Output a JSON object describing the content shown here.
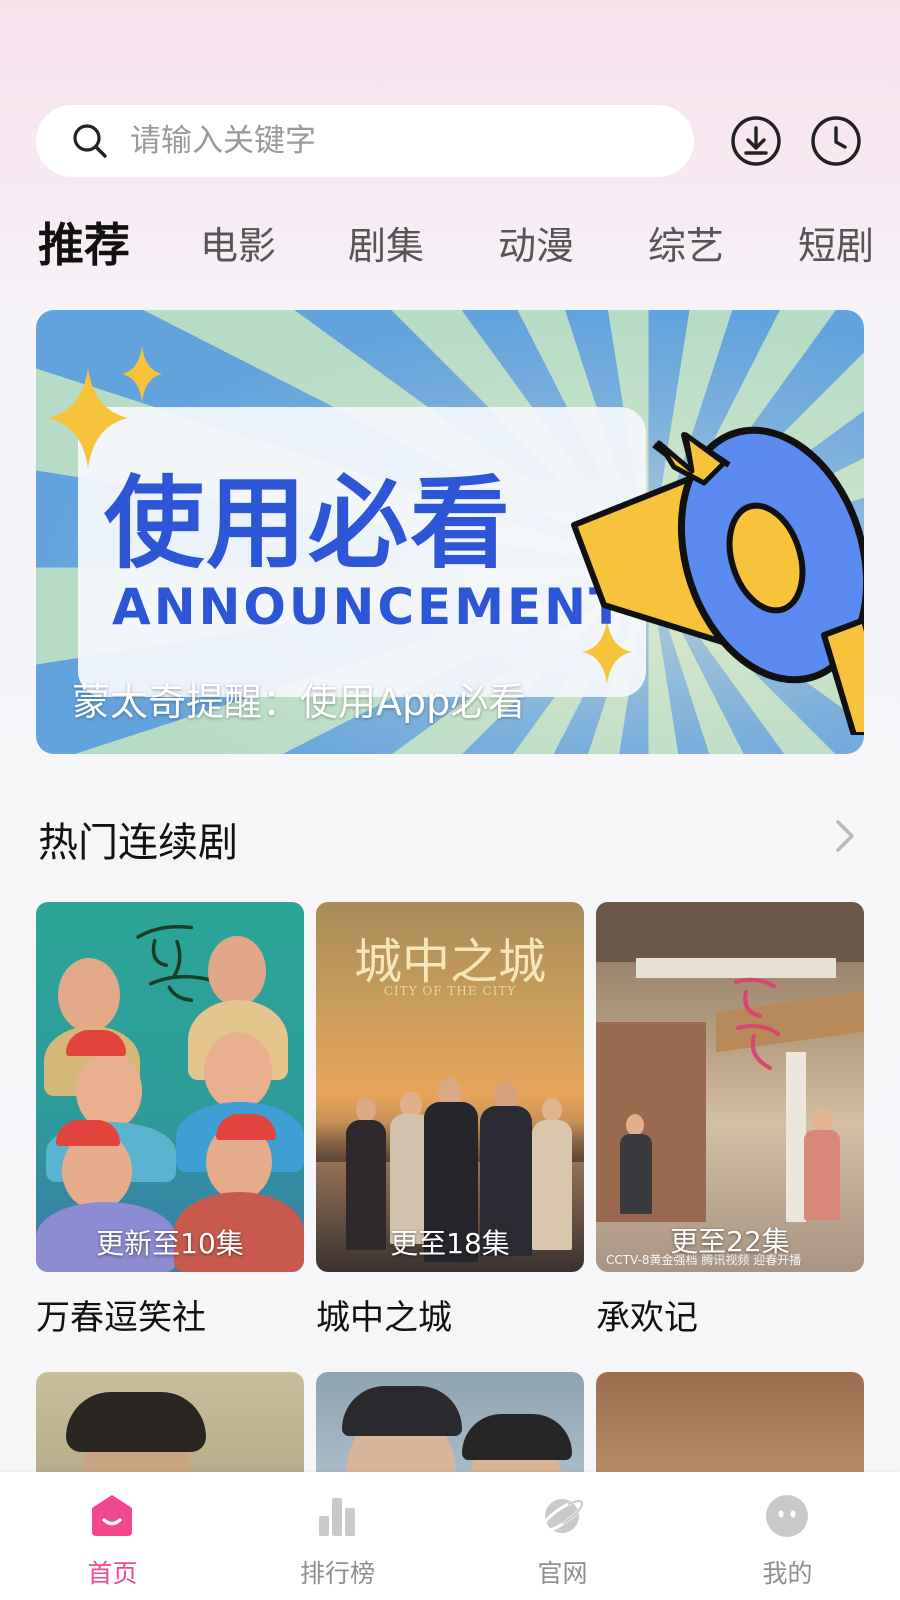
{
  "search": {
    "placeholder": "请输入关键字"
  },
  "header": {
    "download_icon": "download-icon",
    "history_icon": "history-clock-icon"
  },
  "tabs": [
    {
      "label": "推荐",
      "active": true
    },
    {
      "label": "电影",
      "active": false
    },
    {
      "label": "剧集",
      "active": false
    },
    {
      "label": "动漫",
      "active": false
    },
    {
      "label": "综艺",
      "active": false
    },
    {
      "label": "短剧",
      "active": false
    }
  ],
  "banner": {
    "headline": "使用必看",
    "subheadline": "ANNOUNCEMENT",
    "caption": "蒙太奇提醒：使用App必看",
    "colors": {
      "accent": "#2d56d6",
      "ray_blue": "#63a3dd",
      "ray_green": "#b6dcc6",
      "megaphone_yellow": "#f7c33a"
    }
  },
  "section": {
    "title": "热门连续剧",
    "more_icon": "chevron-right-icon"
  },
  "shows": [
    {
      "title": "万春逗笑社",
      "badge": "更新至10集"
    },
    {
      "title": "城中之城",
      "badge": "更至18集",
      "poster_title": "城中之城",
      "poster_subtitle": "CITY OF THE CITY"
    },
    {
      "title": "承欢记",
      "badge": "更至22集",
      "poster_footer": "CCTV-8黄金强档 腾讯视频 迎春开播"
    }
  ],
  "bottom_nav": [
    {
      "label": "首页",
      "icon": "home-icon",
      "active": true
    },
    {
      "label": "排行榜",
      "icon": "ranking-chart-icon",
      "active": false
    },
    {
      "label": "官网",
      "icon": "planet-icon",
      "active": false
    },
    {
      "label": "我的",
      "icon": "profile-face-icon",
      "active": false
    }
  ],
  "colors": {
    "active_nav": "#f0478e",
    "inactive_nav": "#8f8f8f"
  }
}
